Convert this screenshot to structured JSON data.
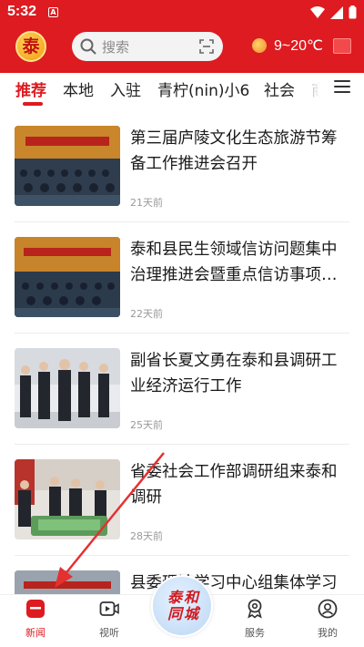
{
  "status_bar": {
    "time": "5:32",
    "notification_badge": "A"
  },
  "header": {
    "logo_char": "泰",
    "search_placeholder": "搜索",
    "weather": "9~20℃",
    "colors": {
      "brand_red": "#dd1b20"
    }
  },
  "tabs": [
    {
      "label": "推荐",
      "active": true
    },
    {
      "label": "本地"
    },
    {
      "label": "入驻"
    },
    {
      "label": "青柠(nin)小6"
    },
    {
      "label": "社会"
    },
    {
      "label": "商"
    }
  ],
  "news": [
    {
      "title": "第三届庐陵文化生态旅游节筹备工作推进会召开",
      "time": "21天前",
      "thumb": "meeting-hall"
    },
    {
      "title": "泰和县民生领域信访问题集中治理推进会暨重点信访事项…",
      "time": "22天前",
      "thumb": "meeting-hall"
    },
    {
      "title": "副省长夏文勇在泰和县调研工业经济运行工作",
      "time": "25天前",
      "thumb": "officials-inspection"
    },
    {
      "title": "省委社会工作部调研组来泰和调研",
      "time": "28天前",
      "thumb": "exhibition-model"
    },
    {
      "title": "县委理论学习中心组集体学习",
      "time": "",
      "thumb": "meeting-hall"
    }
  ],
  "bottom_nav": {
    "items": [
      {
        "label": "新闻",
        "icon": "news-icon",
        "active": true
      },
      {
        "label": "视听",
        "icon": "video-icon"
      },
      {
        "label": "服务",
        "icon": "service-icon"
      },
      {
        "label": "我的",
        "icon": "profile-icon"
      }
    ],
    "center_badge_text": "泰和 同城"
  }
}
